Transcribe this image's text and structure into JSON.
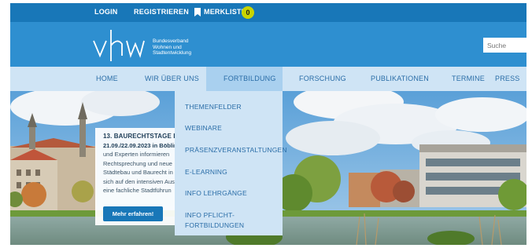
{
  "topbar": {
    "login": "LOGIN",
    "register": "REGISTRIEREN",
    "watchlist": "MERKLISTE",
    "watchlist_count": "0",
    "watchlist_icon": "bookmark-icon",
    "badge_color": "#c8d400"
  },
  "header": {
    "logo_mark": "vhw",
    "logo_lines": [
      "Bundesverband",
      "Wohnen und",
      "Stadtentwicklung"
    ],
    "search_placeholder": "Suche"
  },
  "nav": {
    "items": [
      "HOME",
      "WIR ÜBER UNS",
      "FORTBILDUNG",
      "FORSCHUNG",
      "PUBLIKATIONEN",
      "TERMINE",
      "PRESS"
    ],
    "active_index": 2
  },
  "dropdown": {
    "items": [
      "THEMENFELDER",
      "WEBINARE",
      "PRÄSENZVERANSTALTUNGEN",
      "E-LEARNING",
      "INFO LEHRGÄNGE",
      "INFO PFLICHT-",
      "FORTBILDUNGEN"
    ]
  },
  "teaser": {
    "title": "13. BAURECHTSTAGE BA",
    "date": "21.09./22.09.2023 in Böblin",
    "lines": [
      "und Experten informieren",
      "Rechtsprechung und neue",
      "Städtebau und Baurecht in",
      "sich auf den intensiven Aus",
      "eine fachliche Stadtführun"
    ],
    "button": "Mehr erfahren!"
  },
  "colors": {
    "topbar": "#1877b8",
    "header": "#2e8fd0",
    "nav": "#cfe4f5",
    "nav_active": "#a9d0ef",
    "nav_text": "#2a6da7"
  }
}
